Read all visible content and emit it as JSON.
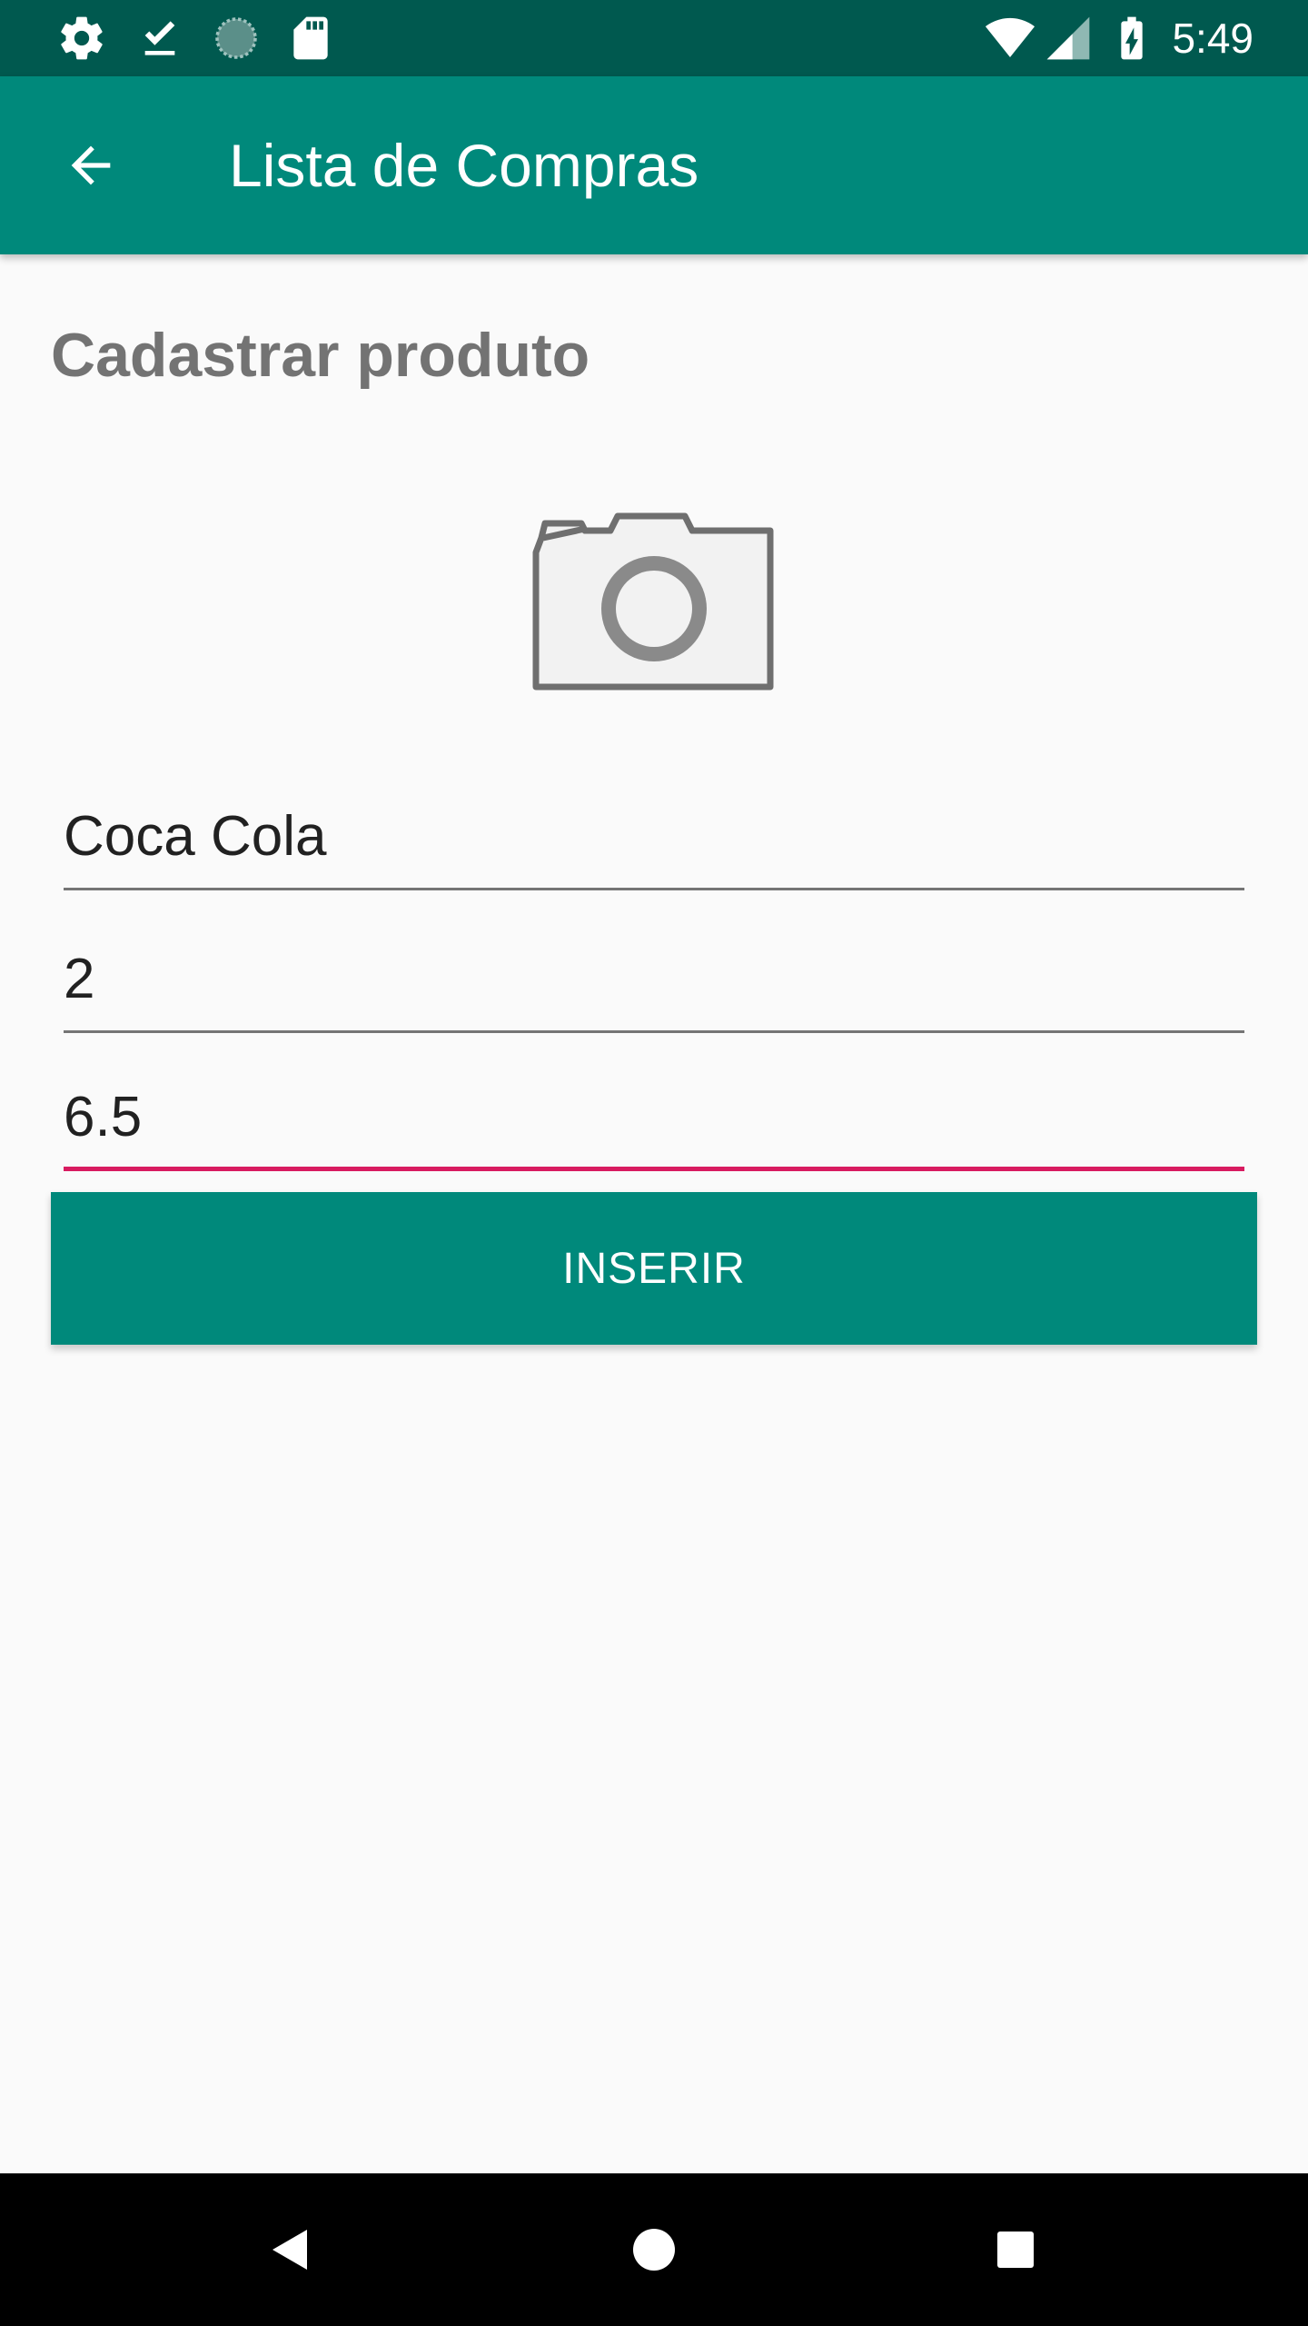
{
  "status_bar": {
    "time": "5:49",
    "left_icons": [
      "settings-icon",
      "download-done-icon",
      "sync-progress-icon",
      "sd-card-icon"
    ],
    "right_icons": [
      "wifi-icon",
      "cell-signal-icon",
      "battery-charging-icon"
    ]
  },
  "app_bar": {
    "title": "Lista de Compras",
    "back_icon": "arrow-back-icon"
  },
  "form": {
    "heading": "Cadastrar produto",
    "photo_icon": "camera-icon",
    "name_value": "Coca Cola",
    "quantity_value": "2",
    "price_value": "6.5",
    "submit_label": "INSERIR"
  },
  "colors": {
    "primary": "#00897b",
    "primary_dark": "#00594f",
    "accent": "#d81b60"
  },
  "nav_bar": {
    "icons": [
      "nav-back-icon",
      "nav-home-icon",
      "nav-recents-icon"
    ]
  }
}
